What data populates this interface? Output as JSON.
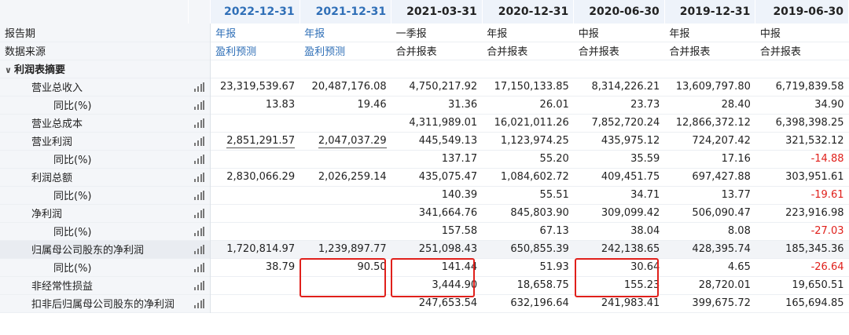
{
  "columns": [
    {
      "date": "2022-12-31",
      "type": "年报",
      "source": "盈利预测",
      "forecast": true
    },
    {
      "date": "2021-12-31",
      "type": "年报",
      "source": "盈利预测",
      "forecast": true
    },
    {
      "date": "2021-03-31",
      "type": "一季报",
      "source": "合并报表",
      "forecast": false
    },
    {
      "date": "2020-12-31",
      "type": "年报",
      "source": "合并报表",
      "forecast": false
    },
    {
      "date": "2020-06-30",
      "type": "中报",
      "source": "合并报表",
      "forecast": false
    },
    {
      "date": "2019-12-31",
      "type": "年报",
      "source": "合并报表",
      "forecast": false
    },
    {
      "date": "2019-06-30",
      "type": "中报",
      "source": "合并报表",
      "forecast": false
    }
  ],
  "labels": {
    "report_period": "报告期",
    "data_source": "数据来源",
    "section": "利润表摘要"
  },
  "rows": [
    {
      "label": "营业总收入",
      "indent": 1,
      "values": [
        "23,319,539.67",
        "20,487,176.08",
        "4,750,217.92",
        "17,150,133.85",
        "8,314,226.21",
        "13,609,797.80",
        "6,719,839.58"
      ]
    },
    {
      "label": "同比(%)",
      "indent": 2,
      "values": [
        "13.83",
        "19.46",
        "31.36",
        "26.01",
        "23.73",
        "28.40",
        "34.90"
      ]
    },
    {
      "label": "营业总成本",
      "indent": 1,
      "values": [
        "",
        "",
        "4,311,989.01",
        "16,021,011.26",
        "7,852,720.24",
        "12,866,372.12",
        "6,398,398.25"
      ]
    },
    {
      "label": "营业利润",
      "indent": 1,
      "values": [
        "2,851,291.57",
        "2,047,037.29",
        "445,549.13",
        "1,123,974.25",
        "435,975.12",
        "724,207.42",
        "321,532.12"
      ]
    },
    {
      "label": "同比(%)",
      "indent": 2,
      "values": [
        "",
        "",
        "137.17",
        "55.20",
        "35.59",
        "17.16",
        "-14.88"
      ]
    },
    {
      "label": "利润总额",
      "indent": 1,
      "values": [
        "2,830,066.29",
        "2,026,259.14",
        "435,075.47",
        "1,084,602.72",
        "409,451.75",
        "697,427.88",
        "303,951.61"
      ]
    },
    {
      "label": "同比(%)",
      "indent": 2,
      "values": [
        "",
        "",
        "140.39",
        "55.51",
        "34.71",
        "13.77",
        "-19.61"
      ]
    },
    {
      "label": "净利润",
      "indent": 1,
      "values": [
        "",
        "",
        "341,664.76",
        "845,803.90",
        "309,099.42",
        "506,090.47",
        "223,916.98"
      ]
    },
    {
      "label": "同比(%)",
      "indent": 2,
      "values": [
        "",
        "",
        "157.58",
        "67.13",
        "38.04",
        "8.08",
        "-27.03"
      ]
    },
    {
      "label": "归属母公司股东的净利润",
      "indent": 1,
      "values": [
        "1,720,814.97",
        "1,239,897.77",
        "251,098.43",
        "650,855.39",
        "242,138.65",
        "428,395.74",
        "185,345.36"
      ]
    },
    {
      "label": "同比(%)",
      "indent": 2,
      "values": [
        "38.79",
        "90.50",
        "141.44",
        "51.93",
        "30.64",
        "4.65",
        "-26.64"
      ]
    },
    {
      "label": "非经常性损益",
      "indent": 1,
      "values": [
        "",
        "",
        "3,444.90",
        "18,658.75",
        "155.23",
        "28,720.01",
        "19,650.51"
      ]
    },
    {
      "label": "扣非后归属母公司股东的净利润",
      "indent": 1,
      "values": [
        "",
        "",
        "247,653.54",
        "632,196.64",
        "241,983.41",
        "399,675.72",
        "165,694.85"
      ]
    }
  ]
}
